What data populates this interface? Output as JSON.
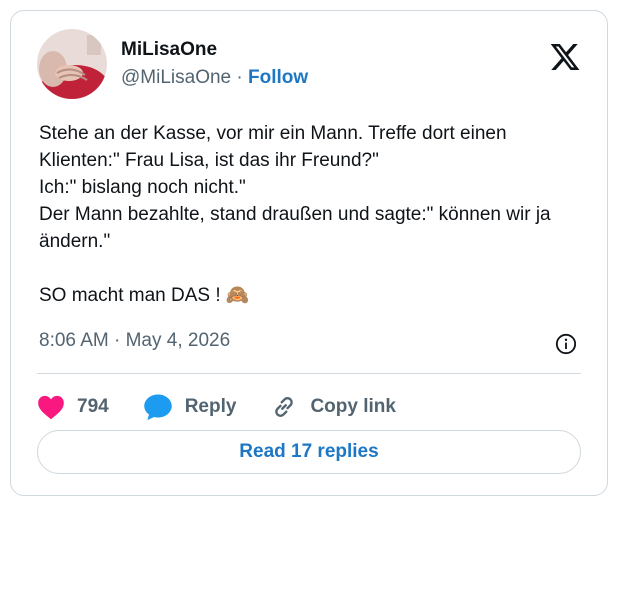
{
  "author": {
    "display_name": "MiLisaOne",
    "handle": "@MiLisaOne",
    "separator": "·",
    "follow_label": "Follow"
  },
  "post": {
    "text": "Stehe an der Kasse, vor mir ein Mann. Treffe dort einen Klienten:\" Frau Lisa, ist das ihr Freund?\"\nIch:\" bislang noch nicht.\"\nDer Mann bezahlte, stand draußen und sagte:\" können wir ja ändern.\"\n\nSO macht man DAS ! 🙈",
    "time": "8:06 AM",
    "separator": "·",
    "date": "May 4, 2026"
  },
  "actions": {
    "like_count": "794",
    "reply_label": "Reply",
    "copy_link_label": "Copy link",
    "read_replies_label": "Read 17 replies"
  },
  "icons": {
    "platform": "x-logo-icon",
    "info": "info-icon",
    "like": "heart-icon",
    "reply": "speech-bubble-icon",
    "copy": "link-icon"
  },
  "colors": {
    "accent": "#1d77c4",
    "like": "#f91880",
    "reply_icon": "#1d9bf0",
    "muted": "#536471",
    "border": "#cfd9de"
  }
}
